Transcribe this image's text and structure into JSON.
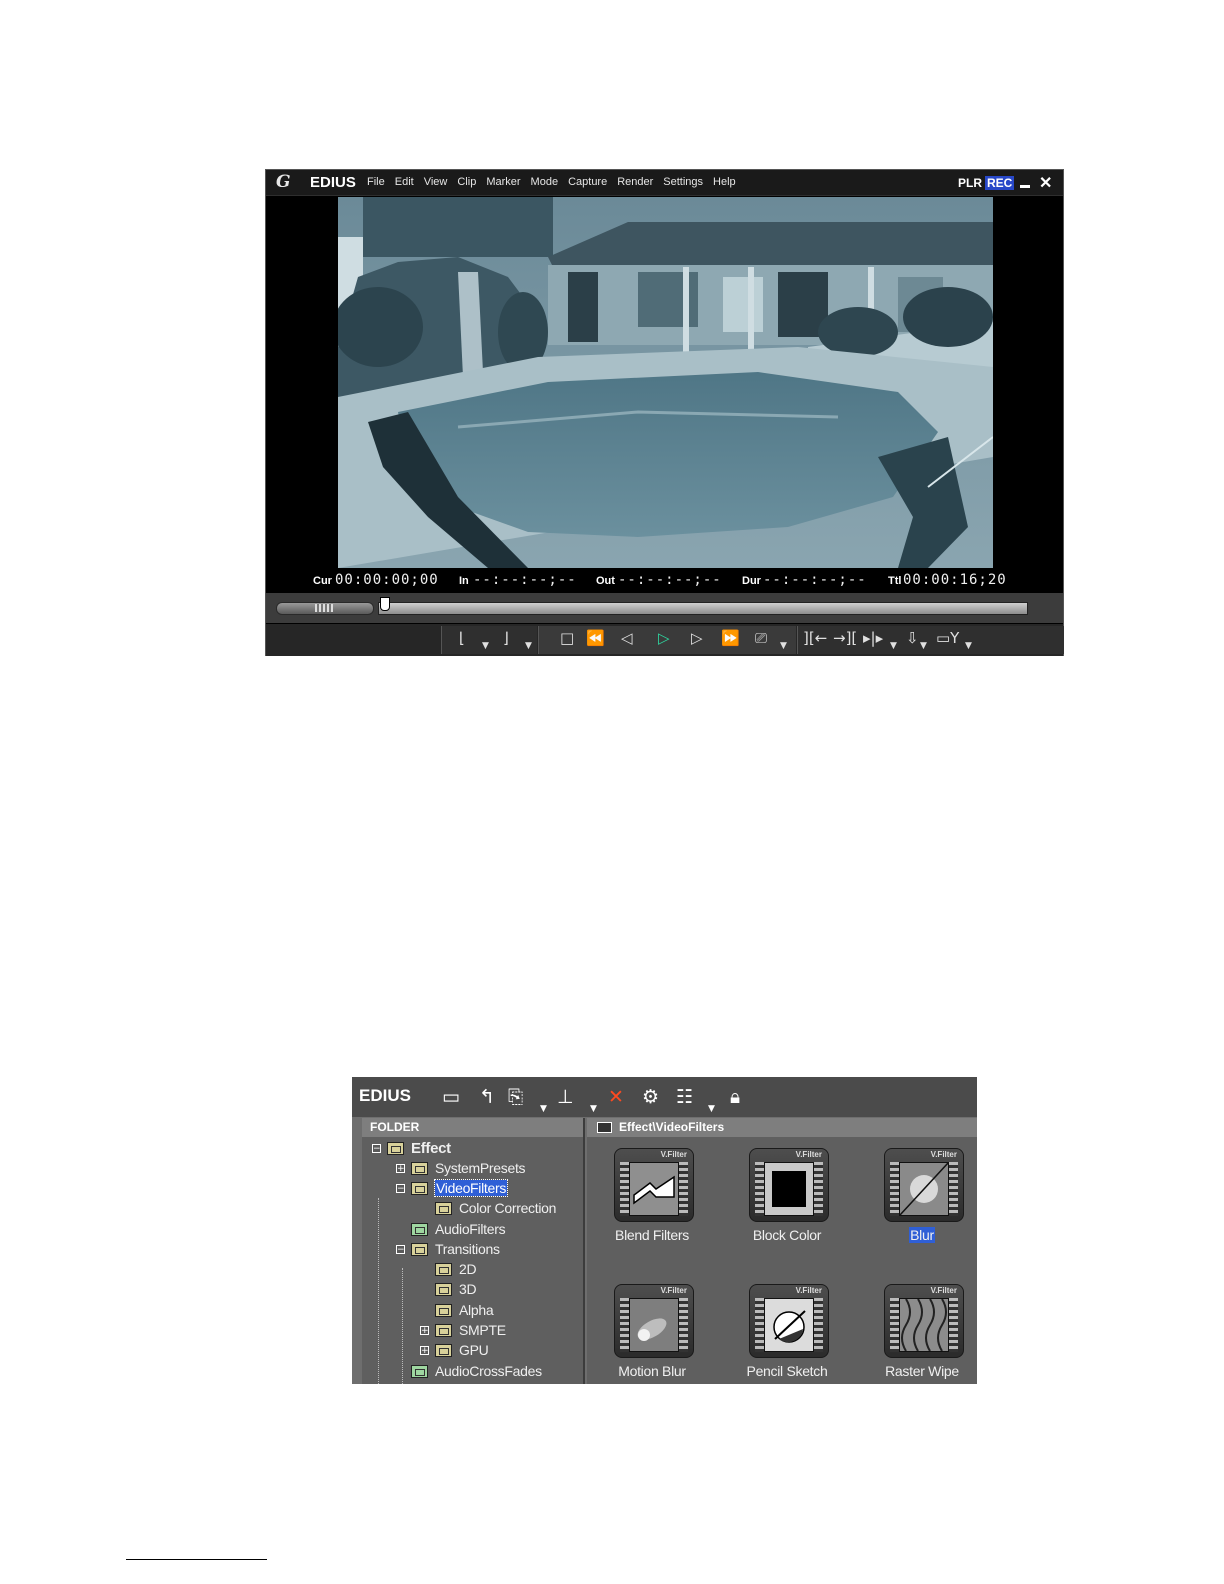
{
  "player": {
    "logo": "G",
    "brand": "EDIUS",
    "menu": [
      "File",
      "Edit",
      "View",
      "Clip",
      "Marker",
      "Mode",
      "Capture",
      "Render",
      "Settings",
      "Help"
    ],
    "mode_plr": "PLR",
    "mode_rec": "REC",
    "timecodes": {
      "cur_label": "Cur",
      "cur_value": "00:00:00;00",
      "in_label": "In",
      "in_value": "--:--:--;--",
      "out_label": "Out",
      "out_value": "--:--:--;--",
      "dur_label": "Dur",
      "dur_value": "--:--:--;--",
      "ttl_label": "Ttl",
      "ttl_value": "00:00:16;20"
    }
  },
  "effect_panel": {
    "brand": "EDIUS",
    "folder_header": "FOLDER",
    "tree": [
      {
        "label": "Effect"
      },
      {
        "label": "SystemPresets"
      },
      {
        "label": "VideoFilters"
      },
      {
        "label": "Color Correction"
      },
      {
        "label": "AudioFilters"
      },
      {
        "label": "Transitions"
      },
      {
        "label": "2D"
      },
      {
        "label": "3D"
      },
      {
        "label": "Alpha"
      },
      {
        "label": "SMPTE"
      },
      {
        "label": "GPU"
      },
      {
        "label": "AudioCrossFades"
      }
    ],
    "path": "Effect\\VideoFilters",
    "tag": "V.Filter",
    "tiles": [
      {
        "label": "Blend Filters"
      },
      {
        "label": "Block Color"
      },
      {
        "label": "Blur"
      },
      {
        "label": "Motion Blur"
      },
      {
        "label": "Pencil Sketch"
      },
      {
        "label": "Raster Wipe"
      }
    ]
  }
}
